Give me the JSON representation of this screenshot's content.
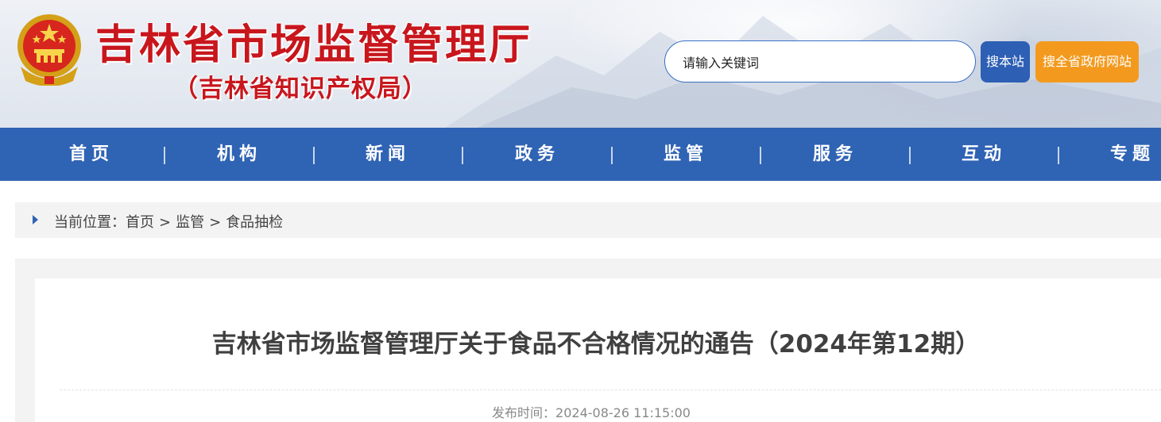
{
  "header": {
    "title": "吉林省市场监督管理厅",
    "subtitle": "（吉林省知识产权局）",
    "search_placeholder": "请输入关键词",
    "search_site_label": "搜本站",
    "search_province_label": "搜全省政府网站"
  },
  "nav": {
    "items": [
      {
        "label": "首页"
      },
      {
        "label": "机构"
      },
      {
        "label": "新闻"
      },
      {
        "label": "政务"
      },
      {
        "label": "监管"
      },
      {
        "label": "服务"
      },
      {
        "label": "互动"
      },
      {
        "label": "专题"
      }
    ]
  },
  "breadcrumb": {
    "prefix": "当前位置：",
    "items": [
      "首页",
      "监管",
      "食品抽检"
    ],
    "separator": ">"
  },
  "article": {
    "title": "吉林省市场监督管理厅关于食品不合格情况的通告（2024年第12期）",
    "publish_label": "发布时间：",
    "publish_time": "2024-08-26 11:15:00"
  },
  "colors": {
    "brand_red": "#c8161d",
    "nav_blue": "#2f63b4",
    "search_button_blue": "#2d5fb4",
    "search_button_orange": "#f39a1e"
  },
  "icons": [
    "national-emblem-icon",
    "breadcrumb-arrow-icon"
  ]
}
